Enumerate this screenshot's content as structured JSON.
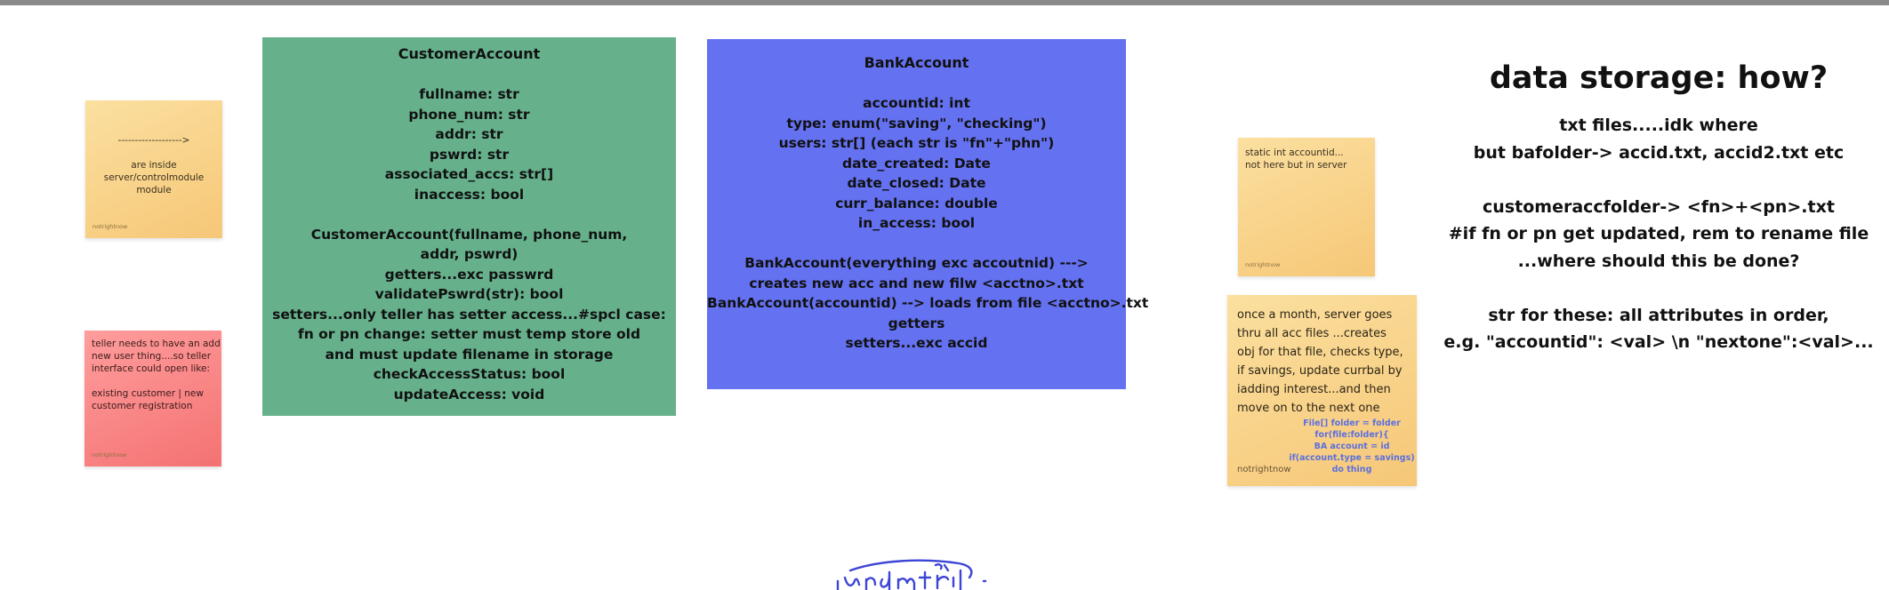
{
  "customer_account": {
    "title": "CustomerAccount",
    "lines": [
      "",
      "fullname: str",
      "phone_num: str",
      "addr: str",
      "pswrd: str",
      "associated_accs: str[]",
      "inaccess: bool",
      "",
      "CustomerAccount(fullname, phone_num,",
      "addr, pswrd)",
      "getters...exc passwrd",
      "validatePswrd(str): bool",
      "setters...only teller has setter access...#spcl case:",
      "fn or pn change: setter must temp store old",
      "and must update filename in storage",
      "checkAccessStatus: bool",
      "updateAccess: void"
    ]
  },
  "bank_account": {
    "title": "BankAccount",
    "lines": [
      "",
      "accountid: int",
      "type: enum(\"saving\", \"checking\")",
      "users: str[] (each str is \"fn\"+\"phn\")",
      "date_created: Date",
      "date_closed: Date",
      "curr_balance: double",
      "in_access: bool",
      "",
      "BankAccount(everything exc accoutnid) --->",
      "creates new acc and new filw <acctno>.txt",
      "BankAccount(accountid) --> loads from file <acctno>.txt",
      "getters",
      "setters...exc accid"
    ]
  },
  "sticky_notes": {
    "arrow_note": {
      "lines": [
        "------------------->",
        "",
        "are inside",
        "server/controlmodule",
        "module"
      ],
      "author": "notrightnow"
    },
    "teller_note": {
      "lines": [
        "teller needs to have an add",
        "new user thing....so teller",
        "interface could open like:",
        "",
        "existing customer | new",
        "customer registration"
      ],
      "author": "notrightnow"
    },
    "static_note": {
      "lines": [
        "static int accountid...",
        "not here but in server"
      ],
      "author": "notrightnow"
    },
    "monthly_note": {
      "lines": [
        "once a month, server goes",
        "thru all acc files ...creates",
        "obj for that file, checks type,",
        "if savings, update currbal by",
        "iadding interest...and then",
        "move on to the next one"
      ],
      "code_lines": [
        "File[] folder = folder",
        "for(file:folder){",
        "BA account = id",
        "if(account.type = savings)",
        "do thing"
      ],
      "author": "notrightnow"
    }
  },
  "storage_notes": {
    "heading": "data storage: how?",
    "lines": [
      "txt files.....idk where",
      "but bafolder-> accid.txt, accid2.txt etc",
      "",
      "customeraccfolder-> <fn>+<pn>.txt",
      "#if fn or pn get updated, rem to rename file",
      "...where should this be done?",
      "",
      "str for these: all attributes in order,",
      "e.g. \"accountid\": <val> \\n \"nextone\":<val>..."
    ]
  },
  "colors": {
    "customer_card": "#66b08c",
    "bank_card": "#6471f0",
    "sticky_yellow": "#f6c777",
    "sticky_red": "#f47272",
    "scribble": "#3d45d6"
  }
}
